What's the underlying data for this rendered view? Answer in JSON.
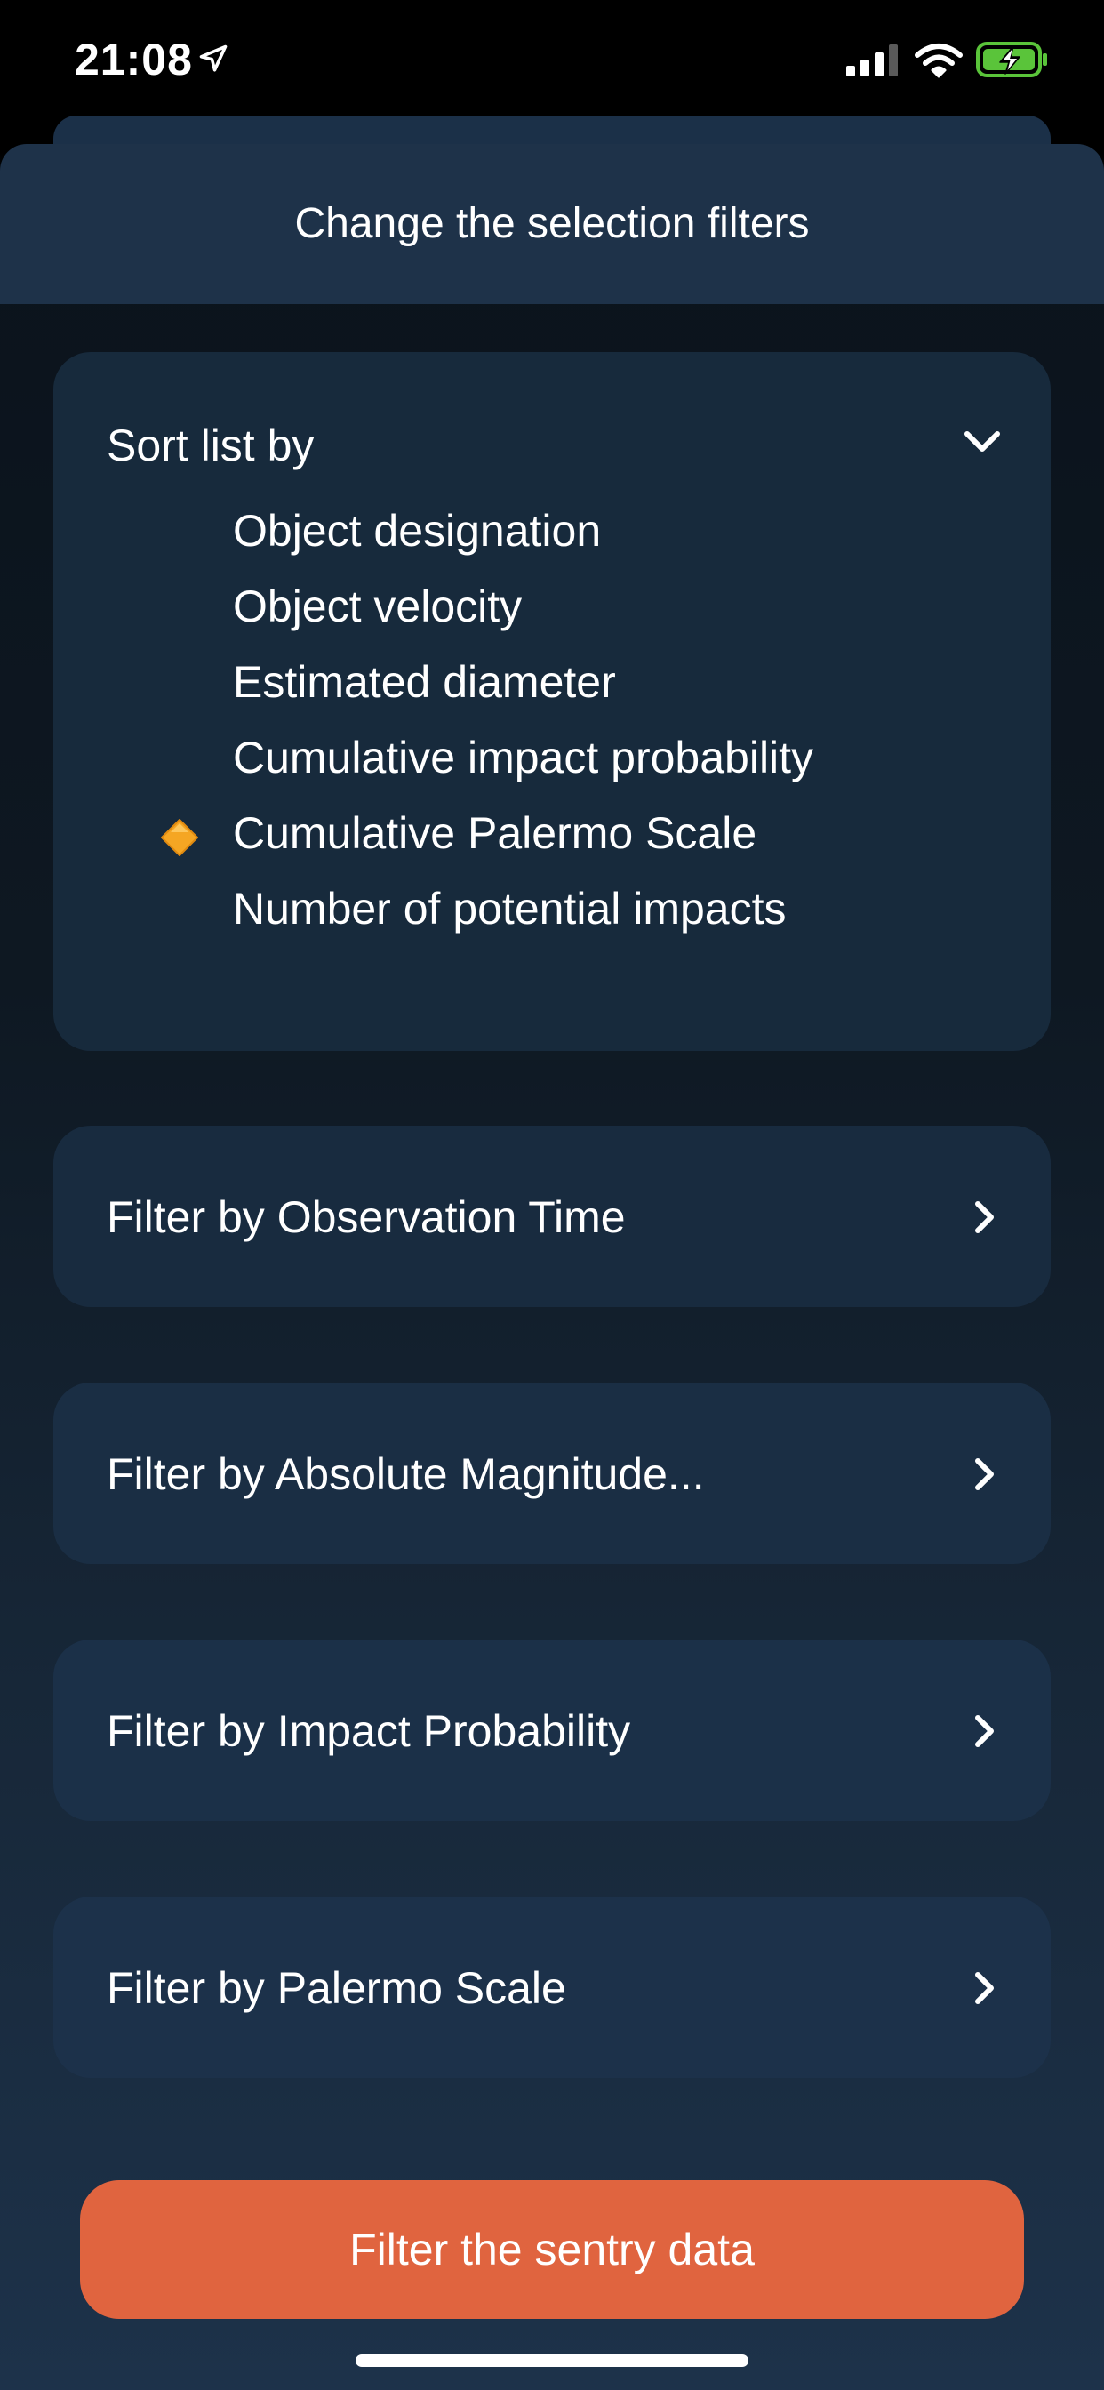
{
  "status_bar": {
    "time": "21:08",
    "icons": [
      "location-arrow-icon",
      "signal-bars-icon",
      "wifi-icon",
      "battery-charging-icon"
    ],
    "battery_color": "#5ac43a"
  },
  "sheet": {
    "title": "Change the selection filters"
  },
  "sort": {
    "label": "Sort list by",
    "expanded": true,
    "options": [
      {
        "label": "Object designation",
        "selected": false
      },
      {
        "label": "Object velocity",
        "selected": false
      },
      {
        "label": "Estimated diameter",
        "selected": false
      },
      {
        "label": "Cumulative impact probability",
        "selected": false
      },
      {
        "label": "Cumulative Palermo Scale",
        "selected": true
      },
      {
        "label": "Number of potential impacts",
        "selected": false
      }
    ],
    "selected_icon": "orange-diamond-icon"
  },
  "filters": [
    {
      "label": "Filter by Observation Time"
    },
    {
      "label": "Filter by Absolute Magnitude..."
    },
    {
      "label": "Filter by Impact Probability"
    },
    {
      "label": "Filter by Palermo Scale"
    }
  ],
  "action": {
    "label": "Filter the sentry data",
    "color": "#e0643f"
  },
  "colors": {
    "card": "#182a3d",
    "header": "#1e3249",
    "accent_diamond": "#f5a623"
  }
}
